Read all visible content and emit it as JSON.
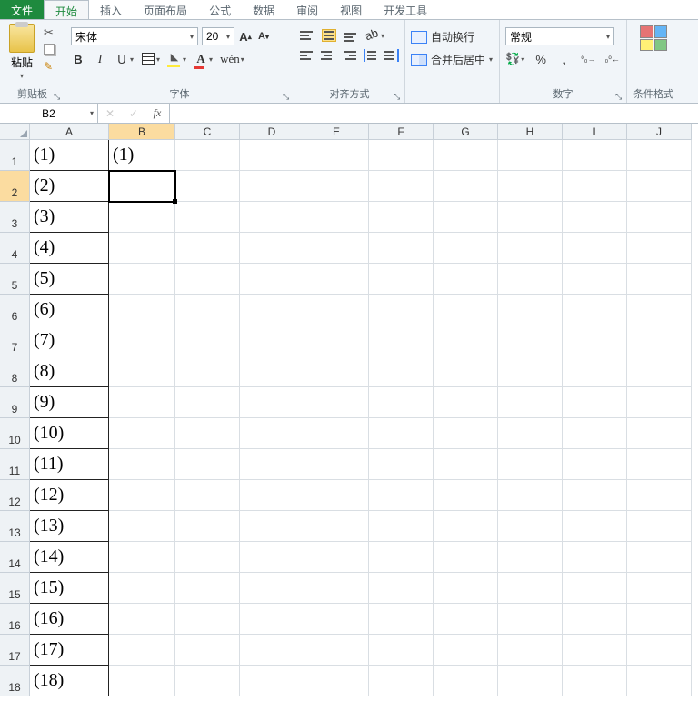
{
  "tabs": {
    "file": "文件",
    "home": "开始",
    "insert": "插入",
    "layout": "页面布局",
    "formula": "公式",
    "data": "数据",
    "review": "审阅",
    "view": "视图",
    "dev": "开发工具"
  },
  "ribbon": {
    "clipboard": {
      "label": "剪贴板",
      "paste": "粘贴"
    },
    "font": {
      "label": "字体",
      "name": "宋体",
      "size": "20",
      "bold": "B",
      "italic": "I",
      "underline": "U",
      "wen": "wén"
    },
    "align": {
      "label": "对齐方式"
    },
    "wrap": {
      "wrap_text": "自动换行",
      "merge": "合并后居中"
    },
    "number": {
      "label": "数字",
      "format": "常规",
      "percent": "%",
      "comma": ",",
      "inc": ".0→.00",
      "dec": ".00→.0"
    },
    "cond": {
      "label": "条件格式"
    }
  },
  "namebox": "B2",
  "columns": [
    "A",
    "B",
    "C",
    "D",
    "E",
    "F",
    "G",
    "H",
    "I",
    "J"
  ],
  "selected_cell": {
    "row": 2,
    "col": "B"
  },
  "cells": {
    "A": [
      "(1)",
      "(2)",
      "(3)",
      "(4)",
      "(5)",
      "(6)",
      "(7)",
      "(8)",
      "(9)",
      "(10)",
      "(11)",
      "(12)",
      "(13)",
      "(14)",
      "(15)",
      "(16)",
      "(17)",
      "(18)"
    ],
    "B": [
      "(1)",
      "",
      "",
      "",
      "",
      "",
      "",
      "",
      "",
      "",
      "",
      "",
      "",
      "",
      "",
      "",
      "",
      ""
    ]
  },
  "row_count": 18
}
